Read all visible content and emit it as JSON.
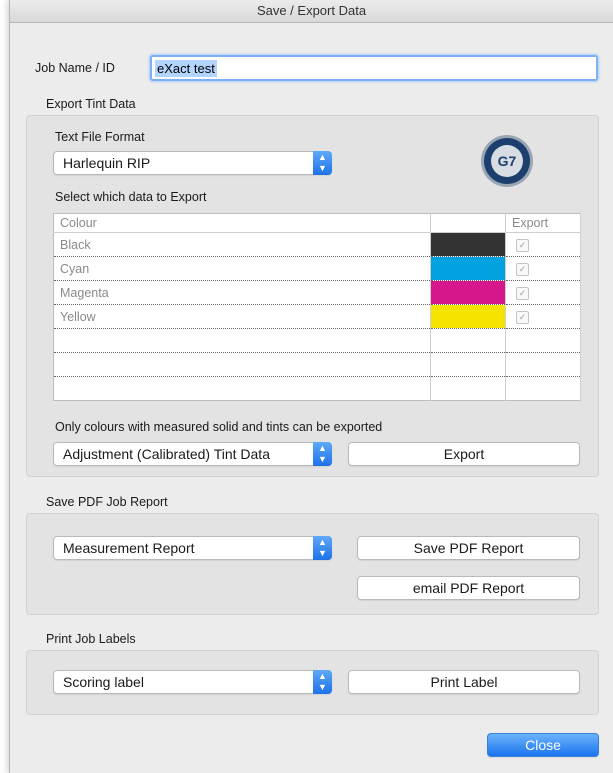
{
  "window": {
    "title": "Save / Export Data"
  },
  "job": {
    "label": "Job Name / ID",
    "value": "eXact test"
  },
  "export_tint": {
    "section_label": "Export Tint Data",
    "format_label": "Text File Format",
    "format_value": "Harlequin RIP",
    "select_label": "Select which data to Export",
    "columns": [
      "Colour",
      "",
      "Export"
    ],
    "rows": [
      {
        "name": "Black",
        "color": "#333333",
        "checked": true
      },
      {
        "name": "Cyan",
        "color": "#00a3e0",
        "checked": true
      },
      {
        "name": "Magenta",
        "color": "#d6168b",
        "checked": true
      },
      {
        "name": "Yellow",
        "color": "#f5e400",
        "checked": true
      }
    ],
    "note": "Only colours with measured solid and tints can be exported",
    "data_type_value": "Adjustment (Calibrated) Tint Data",
    "export_button": "Export",
    "badge_text": "G7"
  },
  "pdf_report": {
    "section_label": "Save PDF Job Report",
    "report_type_value": "Measurement Report",
    "save_button": "Save PDF Report",
    "email_button": "email PDF Report"
  },
  "labels": {
    "section_label": "Print Job Labels",
    "label_type_value": "Scoring label",
    "print_button": "Print Label"
  },
  "footer": {
    "close_button": "Close"
  },
  "theme": {
    "accent": "#1c72e8",
    "group_bg": "#e3e3e3",
    "window_bg": "#ececec"
  }
}
